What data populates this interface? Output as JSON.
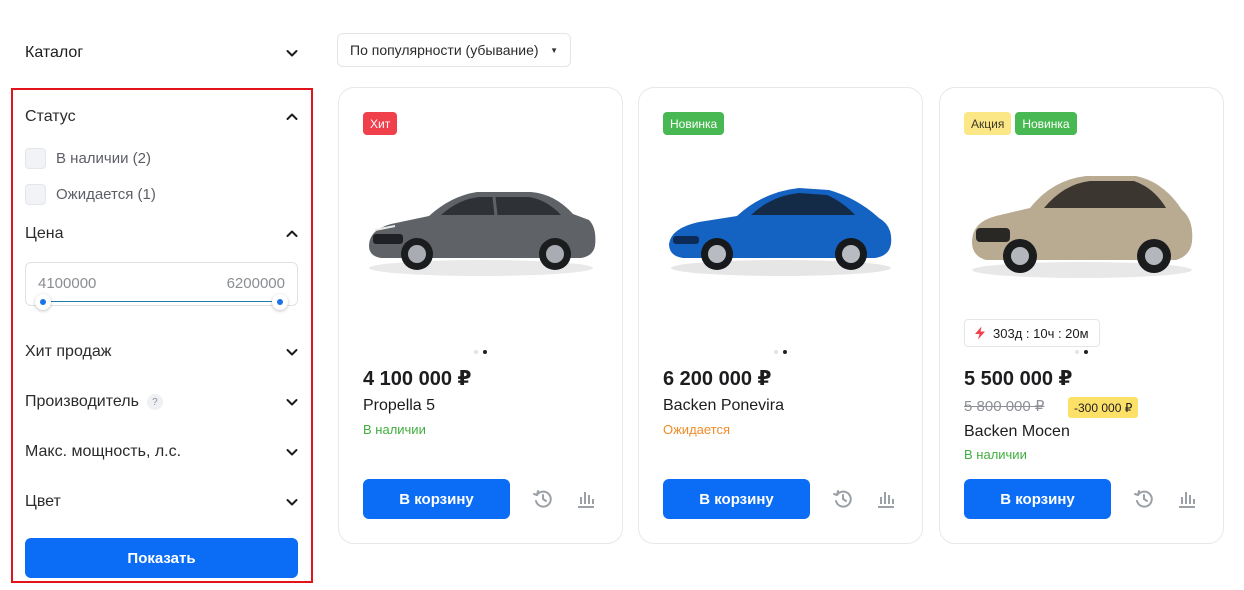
{
  "sidebar": {
    "catalog_label": "Каталог",
    "status_title": "Статус",
    "status_options": [
      {
        "label": "В наличии (2)",
        "checked": false
      },
      {
        "label": "Ожидается (1)",
        "checked": false
      }
    ],
    "price_title": "Цена",
    "price_from": "4100000",
    "price_to": "6200000",
    "bestseller_title": "Хит продаж",
    "manufacturer_title": "Производитель",
    "manufacturer_help": "?",
    "power_title": "Макс. мощность, л.с.",
    "color_title": "Цвет",
    "show_button": "Показать"
  },
  "sort": {
    "value": "По популярности (убывание)"
  },
  "products": [
    {
      "badges": [
        {
          "text": "Хит",
          "type": "hit"
        }
      ],
      "price": "4 100 000 ₽",
      "name": "Propella 5",
      "status": "В наличии",
      "status_type": "in-stock",
      "car_color": "#5f6368",
      "cart_label": "В корзину"
    },
    {
      "badges": [
        {
          "text": "Новинка",
          "type": "new"
        }
      ],
      "price": "6 200 000 ₽",
      "name": "Backen Ponevira",
      "status": "Ожидается",
      "status_type": "expected",
      "car_color": "#1463c2",
      "cart_label": "В корзину"
    },
    {
      "badges": [
        {
          "text": "Акция",
          "type": "promo"
        },
        {
          "text": "Новинка",
          "type": "new"
        }
      ],
      "timer": "303д : 10ч : 20м",
      "price": "5 500 000 ₽",
      "old_price": "5 800 000 ₽",
      "discount": "-300 000 ₽",
      "name": "Backen Mocen",
      "status": "В наличии",
      "status_type": "in-stock",
      "car_color": "#b9aa92",
      "cart_label": "В корзину"
    }
  ],
  "colors": {
    "primary_button": "#0b6df6",
    "highlight_border": "#e1141c",
    "badge_hit": "#f0404b",
    "badge_new": "#47b852",
    "badge_promo": "#fbe785",
    "in_stock": "#3fae3d",
    "expected": "#f28c28"
  }
}
